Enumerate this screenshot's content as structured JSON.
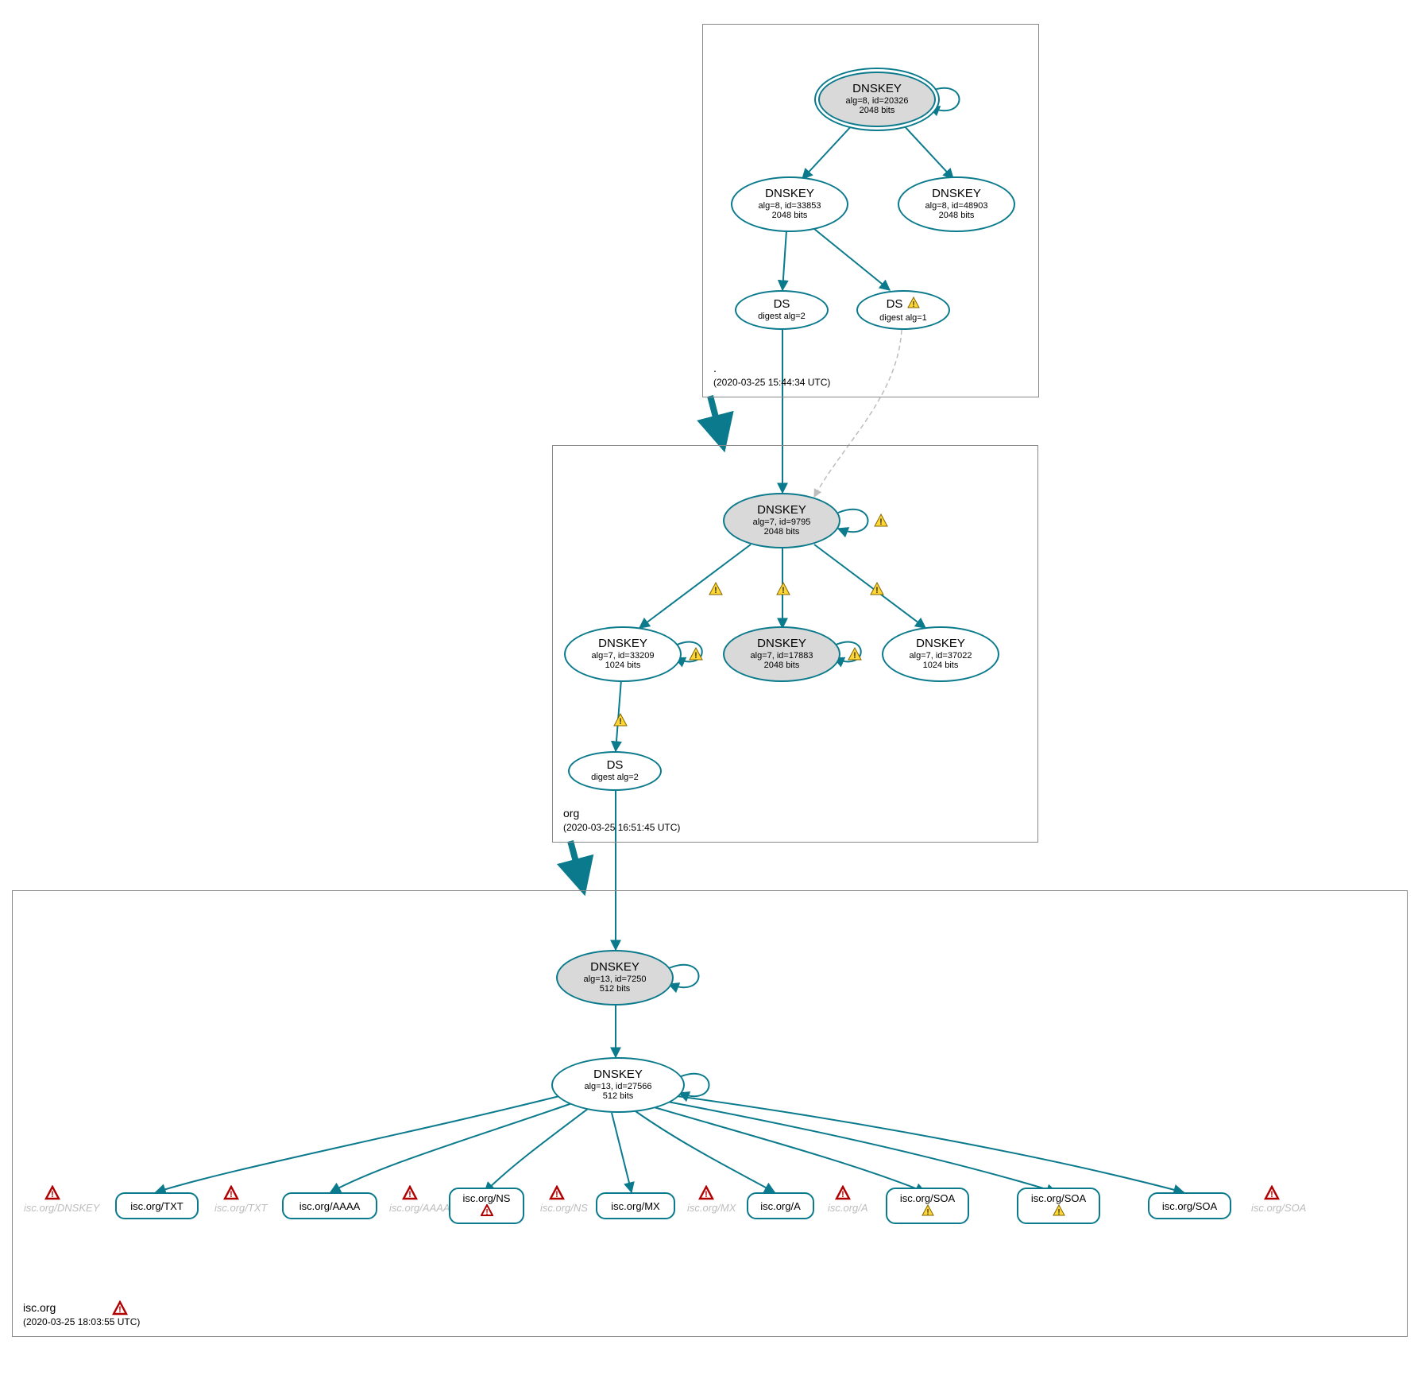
{
  "zones": {
    "root": {
      "name": ".",
      "timestamp": "(2020-03-25 15:44:34 UTC)",
      "nodes": {
        "ksk": {
          "title": "DNSKEY",
          "line1": "alg=8, id=20326",
          "line2": "2048 bits"
        },
        "zsk1": {
          "title": "DNSKEY",
          "line1": "alg=8, id=33853",
          "line2": "2048 bits"
        },
        "zsk2": {
          "title": "DNSKEY",
          "line1": "alg=8, id=48903",
          "line2": "2048 bits"
        },
        "ds1": {
          "title": "DS",
          "line1": "digest alg=2"
        },
        "ds2": {
          "title": "DS",
          "line1": "digest alg=1"
        }
      }
    },
    "org": {
      "name": "org",
      "timestamp": "(2020-03-25 16:51:45 UTC)",
      "nodes": {
        "ksk": {
          "title": "DNSKEY",
          "line1": "alg=7, id=9795",
          "line2": "2048 bits"
        },
        "zsk1": {
          "title": "DNSKEY",
          "line1": "alg=7, id=33209",
          "line2": "1024 bits"
        },
        "zsk2": {
          "title": "DNSKEY",
          "line1": "alg=7, id=17883",
          "line2": "2048 bits"
        },
        "zsk3": {
          "title": "DNSKEY",
          "line1": "alg=7, id=37022",
          "line2": "1024 bits"
        },
        "ds": {
          "title": "DS",
          "line1": "digest alg=2"
        }
      }
    },
    "isc": {
      "name": "isc.org",
      "timestamp": "(2020-03-25 18:03:55 UTC)",
      "nodes": {
        "ksk": {
          "title": "DNSKEY",
          "line1": "alg=13, id=7250",
          "line2": "512 bits"
        },
        "zsk": {
          "title": "DNSKEY",
          "line1": "alg=13, id=27566",
          "line2": "512 bits"
        }
      },
      "rrsets": {
        "txt": "isc.org/TXT",
        "aaaa": "isc.org/AAAA",
        "ns": "isc.org/NS",
        "mx": "isc.org/MX",
        "a": "isc.org/A",
        "soa1": "isc.org/SOA",
        "soa2": "isc.org/SOA",
        "soa3": "isc.org/SOA"
      },
      "ghosts": {
        "dnskey": "isc.org/DNSKEY",
        "txt": "isc.org/TXT",
        "aaaa": "isc.org/AAAA",
        "ns": "isc.org/NS",
        "mx": "isc.org/MX",
        "a": "isc.org/A",
        "soa": "isc.org/SOA"
      }
    }
  }
}
